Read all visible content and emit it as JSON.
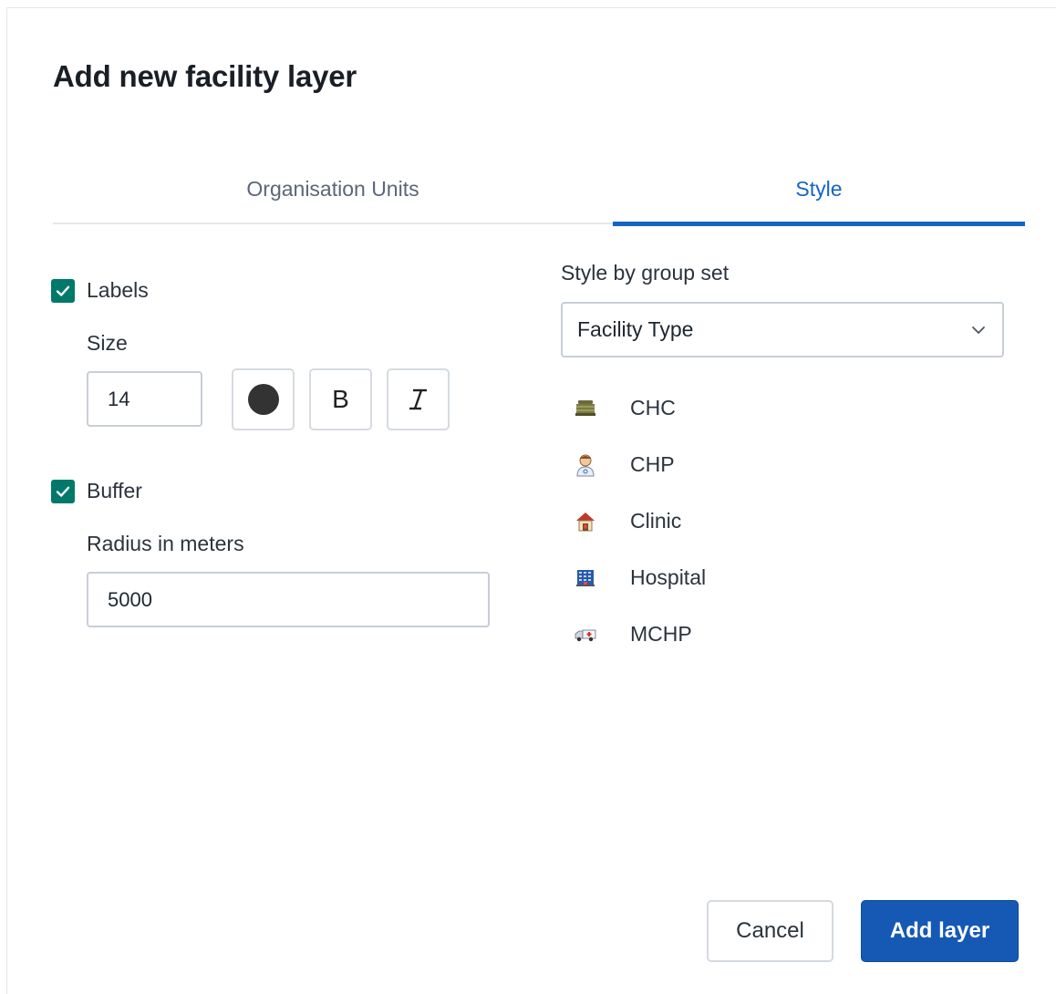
{
  "dialog": {
    "title": "Add new facility layer"
  },
  "tabs": [
    {
      "label": "Organisation Units",
      "active": false
    },
    {
      "label": "Style",
      "active": true
    }
  ],
  "labels": {
    "checkbox_label": "Labels",
    "checked": true,
    "size_label": "Size",
    "size_value": "14",
    "color_value": "#333333",
    "bold_label": "B",
    "italic_label": "I"
  },
  "buffer": {
    "checkbox_label": "Buffer",
    "checked": true,
    "radius_label": "Radius in meters",
    "radius_value": "5000"
  },
  "style_by": {
    "label": "Style by group set",
    "selected": "Facility Type",
    "items": [
      {
        "label": "CHC",
        "icon": "chc-building-icon"
      },
      {
        "label": "CHP",
        "icon": "chp-doctor-icon"
      },
      {
        "label": "Clinic",
        "icon": "clinic-house-icon"
      },
      {
        "label": "Hospital",
        "icon": "hospital-building-icon"
      },
      {
        "label": "MCHP",
        "icon": "mchp-ambulance-icon"
      }
    ]
  },
  "actions": {
    "cancel_label": "Cancel",
    "add_label": "Add layer"
  },
  "colors": {
    "accent": "#1565c0",
    "checkbox": "#00796b",
    "primary_button": "#1559b4"
  }
}
